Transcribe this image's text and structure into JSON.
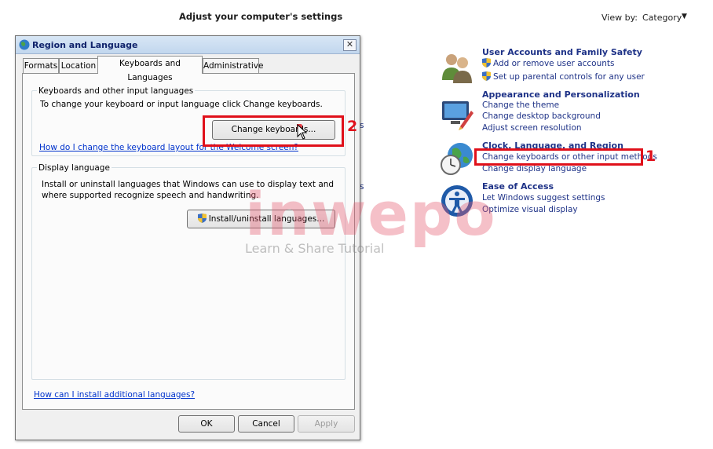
{
  "control_panel": {
    "title": "Adjust your computer's settings",
    "view_by_label": "View by:",
    "view_by_value": "Category",
    "categories": [
      {
        "icon": "user-accounts-icon",
        "title": "User Accounts and Family Safety",
        "links": [
          "Add or remove user accounts",
          "Set up parental controls for any user"
        ]
      },
      {
        "icon": "appearance-icon",
        "title": "Appearance and Personalization",
        "links": [
          "Change the theme",
          "Change desktop background",
          "Adjust screen resolution"
        ]
      },
      {
        "icon": "clock-globe-icon",
        "title": "Clock, Language, and Region",
        "links": [
          "Change keyboards or other input methods",
          "Change display language"
        ]
      },
      {
        "icon": "ease-of-access-icon",
        "title": "Ease of Access",
        "links": [
          "Let Windows suggest settings",
          "Optimize visual display"
        ]
      }
    ],
    "partial_link_fragments": [
      "s",
      "s"
    ]
  },
  "dialog": {
    "title": "Region and Language",
    "close_label": "✕",
    "tabs": [
      "Formats",
      "Location",
      "Keyboards and Languages",
      "Administrative"
    ],
    "active_tab": "Keyboards and Languages",
    "keyboards_group": {
      "title": "Keyboards and other input languages",
      "description": "To change your keyboard or input language click Change keyboards.",
      "button": "Change keyboards...",
      "link": "How do I change the keyboard layout for the Welcome screen?"
    },
    "display_group": {
      "title": "Display language",
      "description_line1": "Install or uninstall languages that Windows can use to display text and",
      "description_line2": "where supported recognize speech and handwriting.",
      "button": "Install/uninstall languages..."
    },
    "bottom_link": "How can I install additional languages?",
    "buttons": {
      "ok": "OK",
      "cancel": "Cancel",
      "apply": "Apply"
    }
  },
  "annotations": {
    "step1": "1",
    "step2": "2"
  },
  "watermark": {
    "main": "inwepo",
    "sub": "Learn & Share Tutorial"
  },
  "colors": {
    "link": "#0033cc",
    "category_title": "#1e3287",
    "highlight": "#e0101a"
  }
}
